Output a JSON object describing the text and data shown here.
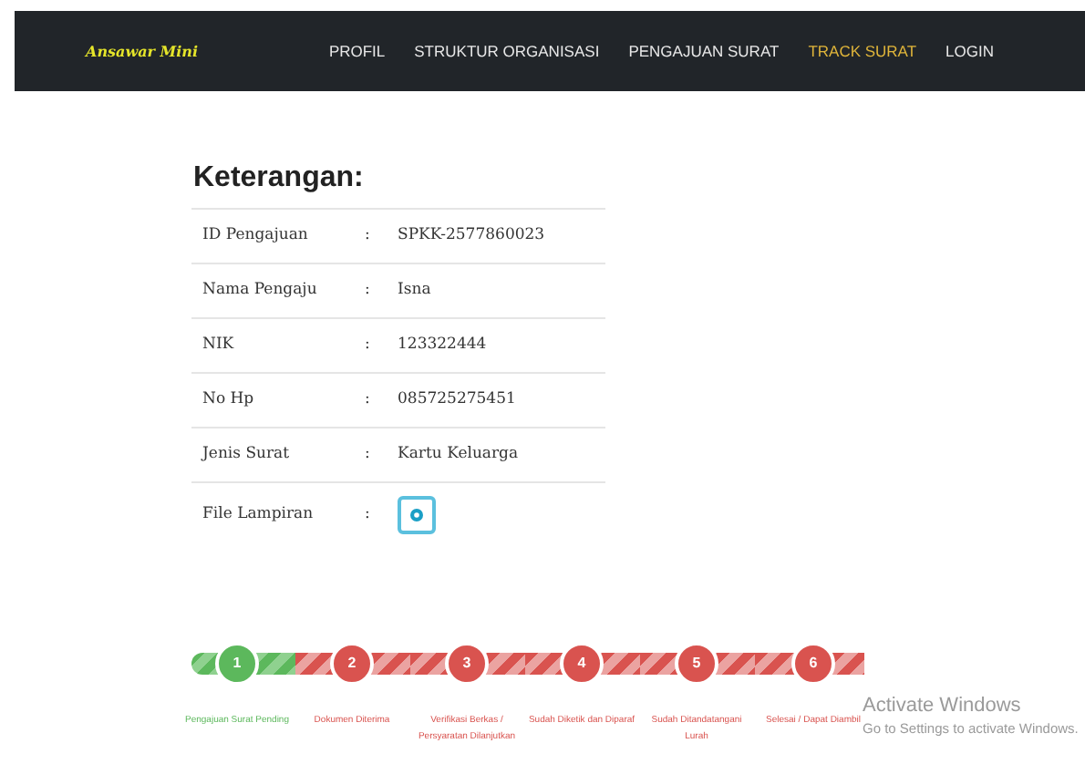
{
  "navbar": {
    "logo": "Ansawar Mini",
    "links": [
      {
        "label": "PROFIL",
        "selected": false
      },
      {
        "label": "STRUKTUR ORGANISASI",
        "selected": false
      },
      {
        "label": "PENGAJUAN SURAT",
        "selected": false
      },
      {
        "label": "TRACK SURAT",
        "selected": true
      },
      {
        "label": "LOGIN",
        "selected": false
      }
    ]
  },
  "details": {
    "title": "Keterangan:",
    "rows": [
      {
        "label": "ID Pengajuan",
        "separator": ":",
        "value": "SPKK-2577860023",
        "kind": "text"
      },
      {
        "label": "Nama Pengaju",
        "separator": ":",
        "value": "Isna",
        "kind": "text"
      },
      {
        "label": "NIK",
        "separator": ":",
        "value": "123322444",
        "kind": "text"
      },
      {
        "label": "No Hp",
        "separator": ":",
        "value": "085725275451",
        "kind": "text"
      },
      {
        "label": "Jenis Surat",
        "separator": ":",
        "value": "Kartu Keluarga",
        "kind": "text"
      },
      {
        "label": "File Lampiran",
        "separator": ":",
        "kind": "attachment"
      }
    ]
  },
  "progress": {
    "steps": [
      {
        "number": "1",
        "label": "Pengajuan Surat Pending",
        "done": true
      },
      {
        "number": "2",
        "label": "Dokumen Diterima",
        "done": false
      },
      {
        "number": "3",
        "label": "Verifikasi Berkas / Persyaratan Dilanjutkan",
        "done": false
      },
      {
        "number": "4",
        "label": "Sudah Diketik dan Diparaf",
        "done": false
      },
      {
        "number": "5",
        "label": "Sudah Ditandatangani Lurah",
        "done": false
      },
      {
        "number": "6",
        "label": "Selesai / Dapat Diambil",
        "done": false
      }
    ]
  },
  "watermark_notice": {
    "title": "Activate Windows",
    "subtitle": "Go to Settings to activate Windows."
  }
}
